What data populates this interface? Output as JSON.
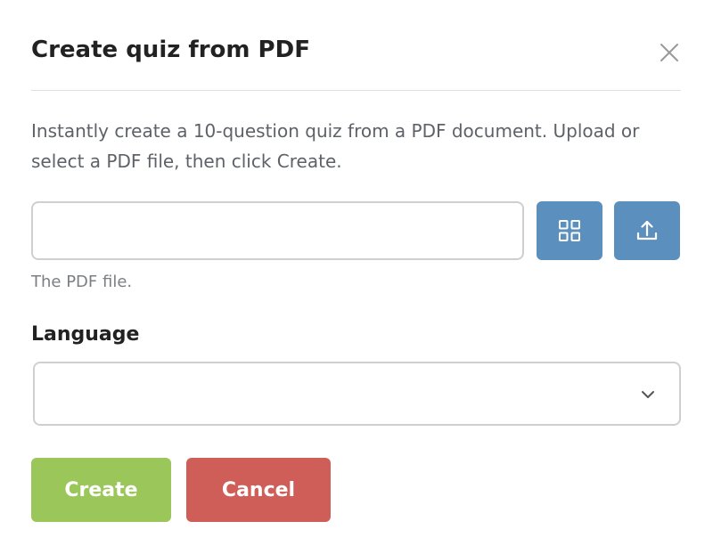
{
  "dialog": {
    "title": "Create quiz from PDF",
    "description": "Instantly create a 10-question quiz from a PDF document. Upload or select a PDF file, then click Create.",
    "file_input": {
      "value": "",
      "placeholder": "",
      "helper_text": "The PDF file."
    },
    "icons": {
      "close": "close-icon",
      "browse": "grid-icon",
      "upload": "upload-icon",
      "select_arrow": "chevron-down-icon"
    },
    "language": {
      "label": "Language",
      "selected": ""
    },
    "buttons": {
      "create": "Create",
      "cancel": "Cancel"
    },
    "colors": {
      "icon_button": "#5b8fbe",
      "create_button": "#9ac65a",
      "cancel_button": "#cf5d58",
      "text_dark": "#222222",
      "text_muted": "#7b7f84"
    }
  }
}
